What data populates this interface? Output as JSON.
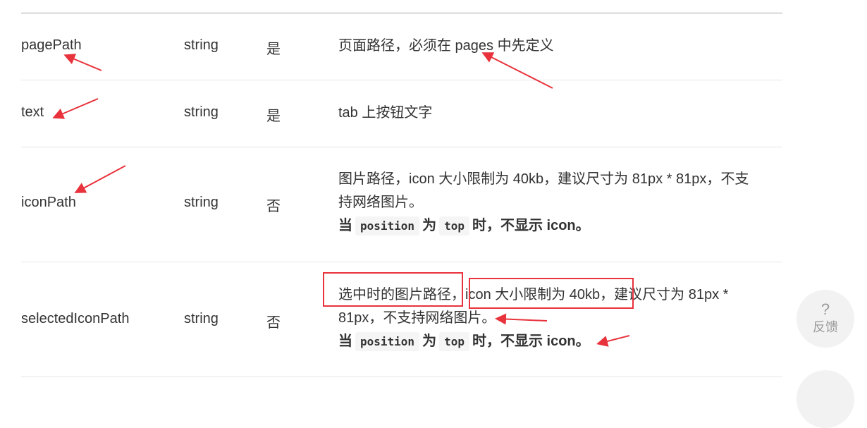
{
  "rows": [
    {
      "name": "pagePath",
      "type": "string",
      "required": "是",
      "desc": [
        "页面路径，必须在 pages 中先定义"
      ]
    },
    {
      "name": "text",
      "type": "string",
      "required": "是",
      "desc": [
        "tab 上按钮文字"
      ]
    },
    {
      "name": "iconPath",
      "type": "string",
      "required": "否",
      "desc": [
        "图片路径，icon 大小限制为 40kb，建议尺寸为 81px * 81px，不支",
        "持网络图片。"
      ],
      "note": {
        "p1": "当",
        "code1": "position",
        "p2": "为",
        "code2": "top",
        "p3": "时，不显示 icon。"
      }
    },
    {
      "name": "selectedIconPath",
      "type": "string",
      "required": "否",
      "desc_parts": {
        "a": "选中时的图片路径，",
        "b": "icon 大小限制为 40kb，",
        "c": "建议尺寸为 81px *"
      },
      "desc_line2": "81px，不支持网络图片。",
      "note": {
        "p1": "当",
        "code1": "position",
        "p2": "为",
        "code2": "top",
        "p3": "时，不显示 icon。"
      }
    }
  ],
  "feedback": {
    "icon": "question-icon",
    "symbol": "?",
    "label": "反馈"
  },
  "annotation_color": "#e8323c"
}
